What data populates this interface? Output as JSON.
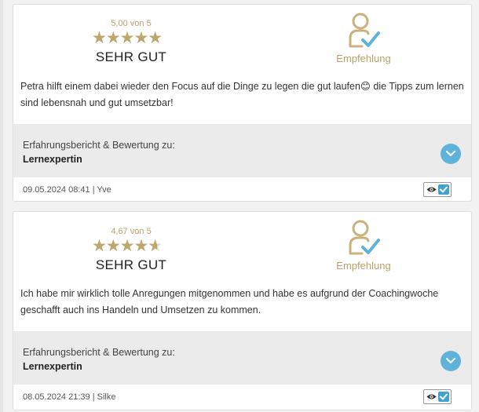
{
  "reviews": [
    {
      "rating": 5.0,
      "rating_max": 5,
      "score_text": "5,00 von 5",
      "verdict": "SEHR GUT",
      "recommendation": "Empfehlung",
      "text": "Petra hilft einem dabei wieder den Focus auf die Dinge zu legen die gut laufen😊 die Tipps zum lernen sind lebensnah und gut umsetzbar!",
      "about_label": "Erfahrungsbericht & Bewertung zu:",
      "about_name": "Lernexpertin",
      "meta": "09.05.2024 08:41 | Yve"
    },
    {
      "rating": 4.67,
      "rating_max": 5,
      "score_text": "4,67 von 5",
      "verdict": "SEHR GUT",
      "recommendation": "Empfehlung",
      "text": "Ich habe mir wirklich tolle Anregungen mitgenommen und habe es aufgrund der Coachingwoche geschafft auch ins Handeln und Umsetzen zu kommen.",
      "about_label": "Erfahrungsbericht & Bewertung zu:",
      "about_name": "Lernexpertin",
      "meta": "08.05.2024 21:39 | Silke"
    }
  ],
  "colors": {
    "gold": "#bfa66a",
    "accent_blue": "#5fb3d9",
    "band_gray": "#ebebeb"
  },
  "icons": {
    "recommend": "user-check-icon",
    "expand": "chevron-down-icon",
    "view": "eye-icon",
    "verified": "checkbox-checked-icon"
  }
}
